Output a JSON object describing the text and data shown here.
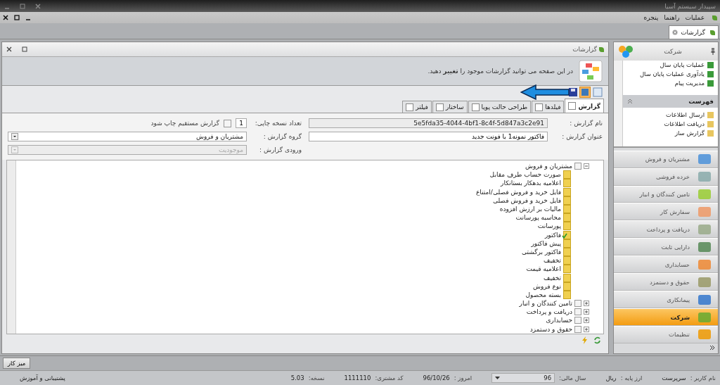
{
  "window": {
    "title": "سپیدار سیستم آسیا"
  },
  "menu": [
    "عملیات",
    "راهنما",
    "پنجره"
  ],
  "doc_tabs": [
    {
      "label": "گزارشات",
      "selected": true
    }
  ],
  "panel": {
    "title": "گزارشات",
    "banner": "در این صفحه می توانید گزارشات موجود را **تغییر** دهید."
  },
  "tabs": [
    {
      "label": "گزارش",
      "selected": true
    },
    {
      "label": "فیلدها",
      "selected": false
    },
    {
      "label": "طراحی حالت پویا",
      "selected": false
    },
    {
      "label": "ساختار",
      "selected": false
    },
    {
      "label": "فیلتر",
      "selected": false
    }
  ],
  "form": {
    "name_label": "نام گزارش :",
    "name_value": "5e5fda35-4044-4bf1-8c4f-5d847a3c2e91",
    "title_label": "عنوان گزارش :",
    "title_value": "فاکتور نمونه1 با فونت جدید",
    "copies_label": "تعداد نسخه چاپی:",
    "copies_value": "1",
    "direct_print_label": "گزارش مستقیم چاپ شود",
    "direct_print_checked": false,
    "group_label": "گروه گزارش :",
    "group_value": "مشتریان و فروش",
    "input_label": "ورودی گزارش :",
    "input_placeholder": "موجودیت",
    "input_disabled": true
  },
  "tree": [
    {
      "label": "مشتریان و فروش",
      "expanded": true,
      "children": [
        {
          "label": "صورت حساب طرف مقابل",
          "checked": false
        },
        {
          "label": "اعلامیه بدهکار بستانکار",
          "checked": false
        },
        {
          "label": "فایل خرید و فروش فصلی/امتناع",
          "checked": false
        },
        {
          "label": "فایل خرید و فروش فصلی",
          "checked": false
        },
        {
          "label": "مالیات بر ارزش افزوده",
          "checked": false
        },
        {
          "label": "محاسبه پورسانت",
          "checked": false
        },
        {
          "label": "پورسانت",
          "checked": false
        },
        {
          "label": "فاکتور",
          "checked": true
        },
        {
          "label": "پیش فاکتور",
          "checked": false
        },
        {
          "label": "فاکتور برگشتی",
          "checked": false
        },
        {
          "label": "تخفیف",
          "checked": false
        },
        {
          "label": "اعلامیه قیمت",
          "checked": false
        },
        {
          "label": "تخفیف",
          "checked": false
        },
        {
          "label": "نوع فروش",
          "checked": false
        },
        {
          "label": "بسته محصول",
          "checked": false
        }
      ]
    },
    {
      "label": "تامین کنندگان و انبار",
      "expanded": false
    },
    {
      "label": "دریافت و پرداخت",
      "expanded": false
    },
    {
      "label": "حسابداری",
      "expanded": false
    },
    {
      "label": "حقوق و دستمزد",
      "expanded": false
    }
  ],
  "sidebar": {
    "title": "شرکت",
    "links": [
      "عملیات پایان سال",
      "یادآوری عملیات پایان سال",
      "مدیریت پیام"
    ],
    "group": "فهرست",
    "group_links": [
      "ارسال اطلاعات",
      "دریافت اطلاعات",
      "گزارش ساز"
    ],
    "modules": [
      {
        "label": "مشتریان و فروش",
        "selected": false
      },
      {
        "label": "خرده فروشی",
        "selected": false
      },
      {
        "label": "تامین کنندگان و انبار",
        "selected": false
      },
      {
        "label": "سفارش کار",
        "selected": false
      },
      {
        "label": "دریافت و پرداخت",
        "selected": false
      },
      {
        "label": "دارایی ثابت",
        "selected": false
      },
      {
        "label": "حسابداری",
        "selected": false
      },
      {
        "label": "حقوق و دستمزد",
        "selected": false
      },
      {
        "label": "پیمانکاری",
        "selected": false
      },
      {
        "label": "شرکت",
        "selected": true
      },
      {
        "label": "تنظیمات",
        "selected": false
      }
    ]
  },
  "desktop_button": "میز کار",
  "status_bar": {
    "items": [
      {
        "label": "نام کاربر :",
        "value": "سرپرست"
      },
      {
        "label": "ارز پایه :",
        "value": "ریال"
      },
      {
        "label": "سال مالی:",
        "value": "96",
        "kind": "dropdown"
      },
      {
        "label": "امروز :",
        "value": "96/10/26"
      },
      {
        "label": "کد مشتری:",
        "value": "1111110"
      },
      {
        "label": "نسخه:",
        "value": "5.03"
      }
    ],
    "support": "پشتیبانی و آموزش"
  }
}
